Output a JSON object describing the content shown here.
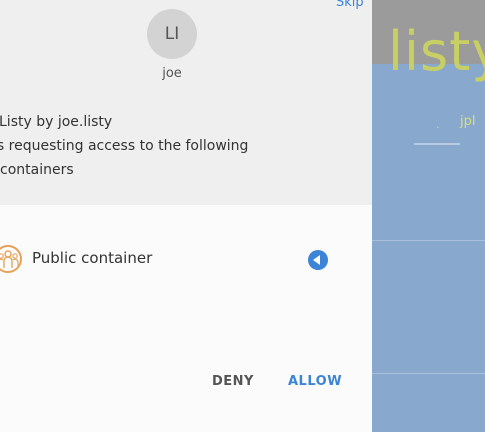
{
  "background_app": {
    "brand_text": "listy",
    "tab_label": "jpl",
    "tab_marker": "."
  },
  "dialog": {
    "skip_label": "Skip",
    "avatar_initials": "LI",
    "username": "joe",
    "request_lines": [
      "Listy by joe.listy",
      "is requesting access to the following",
      "containers"
    ],
    "containers": [
      {
        "label": "Public container",
        "icon": "people-icon"
      }
    ],
    "deny_label": "DENY",
    "allow_label": "ALLOW"
  },
  "colors": {
    "accent": "#3c84d6",
    "header_bg": "#efefef",
    "body_bg": "#fbfbfb",
    "container_icon": "#e4a25a",
    "background_app": "#89a8cd",
    "brand": "#c8d063"
  }
}
